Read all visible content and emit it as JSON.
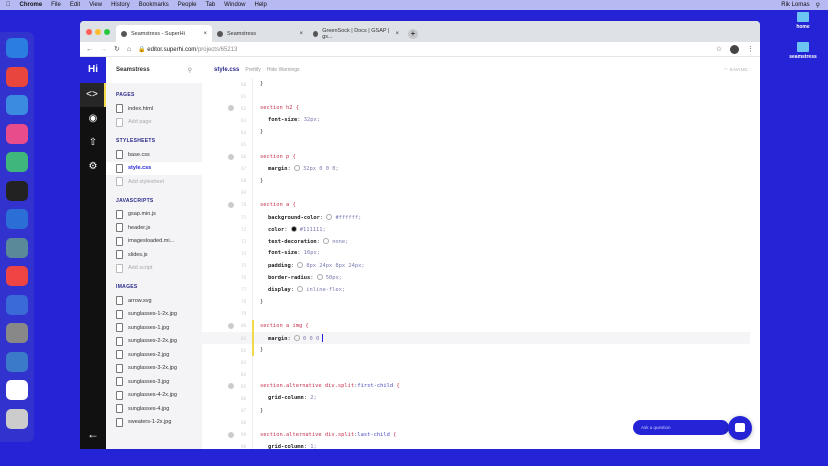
{
  "menubar": {
    "app": "Chrome",
    "items": [
      "File",
      "Edit",
      "View",
      "History",
      "Bookmarks",
      "People",
      "Tab",
      "Window",
      "Help"
    ],
    "user": "Rik Lomas"
  },
  "desktop": {
    "icons": [
      "home",
      "seamstress"
    ]
  },
  "browser": {
    "tabs": [
      {
        "title": "Seamstress - SuperHi",
        "active": true
      },
      {
        "title": "Seamstress",
        "active": false
      },
      {
        "title": "GreenSock | Docs | GSAP | gs...",
        "active": false
      }
    ],
    "url_host": "editor.superhi.com",
    "url_path": "/projects/65213"
  },
  "app": {
    "logo": "Hi",
    "project": "Seamstress",
    "sections": [
      {
        "title": "PAGES",
        "files": [
          "index.html"
        ],
        "add": "Add page"
      },
      {
        "title": "STYLESHEETS",
        "files": [
          "base.css",
          "style.css"
        ],
        "selected": "style.css",
        "add": "Add stylesheet"
      },
      {
        "title": "JAVASCRIPTS",
        "files": [
          "gsap.min.js",
          "header.js",
          "imagesloaded.mi...",
          "slides.js"
        ],
        "add": "Add script"
      },
      {
        "title": "IMAGES",
        "files": [
          "arrow.svg",
          "sunglasses-1-2x.jpg",
          "sunglasses-1.jpg",
          "sunglasses-2-2x.jpg",
          "sunglasses-2.jpg",
          "sunglasses-3-2x.jpg",
          "sunglasses-3.jpg",
          "sunglasses-4-2x.jpg",
          "sunglasses-4.jpg",
          "sweaters-1-2x.jpg"
        ]
      }
    ],
    "editor": {
      "filename": "style.css",
      "prettify": "Prettify",
      "hide_warnings": "Hide Warnings",
      "status": "SAVING",
      "lines": [
        {
          "n": "60",
          "t": "}"
        },
        {
          "n": "61",
          "t": ""
        },
        {
          "n": "62",
          "sel": "section h2 {"
        },
        {
          "n": "63",
          "p": "font-size",
          "v": "32px;"
        },
        {
          "n": "64",
          "t": "}"
        },
        {
          "n": "65",
          "t": ""
        },
        {
          "n": "66",
          "sel": "section p {"
        },
        {
          "n": "67",
          "p": "margin",
          "v": "32px 0 0 0;",
          "sw": "none"
        },
        {
          "n": "68",
          "t": "}"
        },
        {
          "n": "69",
          "t": ""
        },
        {
          "n": "70",
          "sel": "section a {"
        },
        {
          "n": "71",
          "p": "background-color",
          "v": "#ffffff;",
          "sw": "#ffffff"
        },
        {
          "n": "72",
          "p": "color",
          "v": "#111111;",
          "sw": "#111111"
        },
        {
          "n": "73",
          "p": "text-decoration",
          "v": "none;",
          "sw": "none"
        },
        {
          "n": "74",
          "p": "font-size",
          "v": "16px;"
        },
        {
          "n": "75",
          "p": "padding",
          "v": "8px 24px 8px 24px;",
          "sw": "none"
        },
        {
          "n": "76",
          "p": "border-radius",
          "v": "50px;",
          "sw": "none"
        },
        {
          "n": "77",
          "p": "display",
          "v": "inline-flex;",
          "sw": "none"
        },
        {
          "n": "78",
          "t": "}"
        },
        {
          "n": "79",
          "t": ""
        },
        {
          "n": "80",
          "sel": "section a img {",
          "y": true
        },
        {
          "n": "81",
          "p": "margin",
          "v": "0 0 0",
          "sw": "none",
          "cur": true,
          "y": true
        },
        {
          "n": "82",
          "t": "}",
          "y": true
        },
        {
          "n": "83",
          "t": ""
        },
        {
          "n": "84",
          "t": ""
        },
        {
          "n": "85",
          "sel": "section.alternative div.split",
          "pc": ":first-child",
          "end": " {"
        },
        {
          "n": "86",
          "p": "grid-column",
          "v": "2;"
        },
        {
          "n": "87",
          "t": "}"
        },
        {
          "n": "88",
          "t": ""
        },
        {
          "n": "89",
          "sel": "section.alternative div.split",
          "pc": ":last-child",
          "end": " {"
        },
        {
          "n": "90",
          "p": "grid-column",
          "v": "1;"
        }
      ]
    },
    "chat_placeholder": "Ask a question"
  },
  "colors": {
    "brand": "#2424d6",
    "accent": "#f2d94a"
  }
}
